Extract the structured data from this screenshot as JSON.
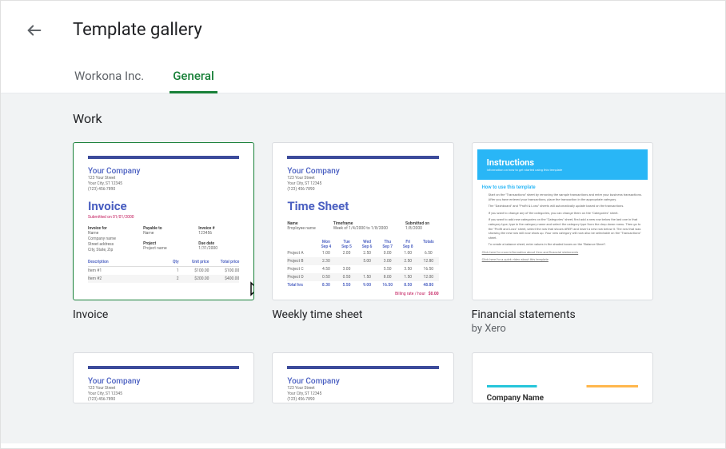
{
  "header": {
    "title": "Template gallery"
  },
  "tabs": [
    {
      "label": "Workona Inc.",
      "active": false
    },
    {
      "label": "General",
      "active": true
    }
  ],
  "section": "Work",
  "templates": [
    {
      "title": "Invoice",
      "selected": true,
      "thumb": {
        "company": "Your Company",
        "addr1": "123 Your Street",
        "addr2": "Your City, ST 12345",
        "phone": "(123) 456-7890",
        "heading": "Invoice",
        "sub": "Submitted on 01/01/2000",
        "cols": [
          {
            "lbl": "Invoice for",
            "v1": "Name",
            "v2": "Company name",
            "v3": "Street address",
            "v4": "City, State, Zip"
          },
          {
            "lbl": "Payable to",
            "v1": "Name",
            "lbl2": "Project",
            "v2": "Project name"
          },
          {
            "lbl": "Invoice #",
            "v1": "123456",
            "lbl2": "Due date",
            "v2": "1/31/2000"
          }
        ],
        "table": {
          "head": [
            "Description",
            "Qty",
            "Unit price",
            "Total price"
          ],
          "rows": [
            [
              "Item #1",
              "1",
              "$100.00",
              "$100.00"
            ],
            [
              "Item #2",
              "2",
              "$200.00",
              "$400.00"
            ]
          ]
        }
      }
    },
    {
      "title": "Weekly time sheet",
      "thumb": {
        "company": "Your Company",
        "addr1": "123 Your Street",
        "addr2": "Your City, ST 12345",
        "phone": "(123) 456-7890",
        "heading": "Time Sheet",
        "cols": [
          {
            "lbl": "Name",
            "v": "Employee name"
          },
          {
            "lbl": "Timeframe",
            "v": "Week of 1/4/2000 to 1/8/2000"
          },
          {
            "lbl": "Submitted on",
            "v": "1/8/2000"
          }
        ],
        "days": [
          "Mon",
          "Tue",
          "Wed",
          "Thu",
          "Fri",
          "Totals"
        ],
        "dates": [
          "Sep 4",
          "Sep 5",
          "Sep 6",
          "Sep 7",
          "Sep 8",
          ""
        ],
        "rows": [
          {
            "name": "Project A",
            "vals": [
              "1.00",
              "2.00",
              "2.50",
              "0.00",
              "1.00",
              "6.50"
            ]
          },
          {
            "name": "Project B",
            "vals": [
              "2.30",
              "",
              "5.00",
              "3.00",
              "2.50",
              "12.80"
            ]
          },
          {
            "name": "Project C",
            "vals": [
              "4.50",
              "3.00",
              "",
              "5.50",
              "3.50",
              "16.50"
            ]
          },
          {
            "name": "Project D",
            "vals": [
              "0.50",
              "0.50",
              "1.50",
              "8.00",
              "1.50",
              "12.00"
            ]
          },
          {
            "name": "Total hrs",
            "vals": [
              "8.30",
              "5.50",
              "9.00",
              "16.50",
              "8.50",
              "48.80"
            ]
          }
        ],
        "bill_lbl": "Billing rate / hour",
        "bill_amt": "$0.00"
      }
    },
    {
      "title": "Financial statements",
      "subtitle": "by Xero",
      "thumb": {
        "banner_title": "Instructions",
        "banner_sub": "Information on how to get started using this template",
        "h": "How to use this template",
        "items": [
          "Start on the \"Transactions\" sheet by removing the sample transactions and enter your business transactions. After you have entered your transactions, place the transaction in the appropriate category.",
          "The \"Dashboard\" and \"Profit & Loss\" sheets will automatically update based on the transactions.",
          "If you want to change any of the categories, you can change them on the \"Categories\" sheet.",
          "If you want to add new categories on the \"Categories\" sheet, first add a new row below the last one in that category type, type in the category name and select the category type from the drop down menu. Then go to the \"Profit and Loss\" sheet, select the row that shows #REF! and insert a new row below it. The row that was showing the new row will now show up. Your new category will now also be selectable on the \"Transactions\" sheet.",
          "To create a balance sheet, enter values in the shaded boxes on the \"Balance Sheet\"."
        ],
        "link1": "Click here for more information about Xero and financial statements",
        "link2": "Click here for a quick video about this template"
      }
    }
  ],
  "row2": [
    {
      "company": "Your Company",
      "addr1": "123 Your Street",
      "addr2": "Your City, ST 12345",
      "phone": "(123) 456-7890"
    },
    {
      "company": "Your Company",
      "addr1": "123 Your Street",
      "addr2": "Your City, ST 12345",
      "phone": "(123) 456-7890"
    },
    {
      "company_name": "Company Name"
    }
  ]
}
